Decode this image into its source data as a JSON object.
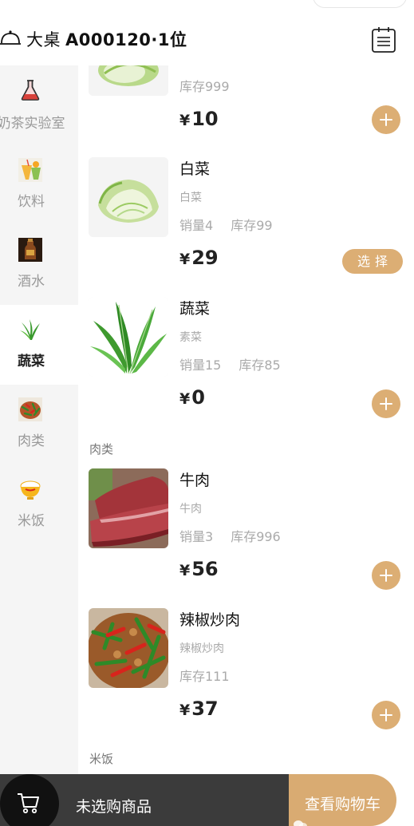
{
  "header": {
    "table_name": "大桌",
    "table_code": "A000120·1位",
    "left_icon": "bell-icon",
    "right_icon": "order-list-icon"
  },
  "sidebar": {
    "categories": [
      {
        "label": "奶茶实验室",
        "icon": "flask-icon",
        "active": false
      },
      {
        "label": "饮料",
        "icon": "drink-icon",
        "active": false
      },
      {
        "label": "酒水",
        "icon": "liquor-icon",
        "active": false
      },
      {
        "label": "蔬菜",
        "icon": "vegetable-icon",
        "active": true
      },
      {
        "label": "肉类",
        "icon": "meat-icon",
        "active": false
      },
      {
        "label": "米饭",
        "icon": "rice-bowl-icon",
        "active": false
      }
    ]
  },
  "products": [
    {
      "name": "",
      "desc": "",
      "stock": "库存999",
      "price": "10",
      "action": "add"
    },
    {
      "name": "白菜",
      "desc": "白菜",
      "sales": "销量4",
      "stock": "库存99",
      "price": "29",
      "action": "select",
      "action_label": "选择"
    },
    {
      "name": "蔬菜",
      "desc": "素菜",
      "sales": "销量15",
      "stock": "库存85",
      "price": "0",
      "action": "add"
    },
    {
      "name": "牛肉",
      "desc": "牛肉",
      "sales": "销量3",
      "stock": "库存996",
      "price": "56",
      "action": "add"
    },
    {
      "name": "辣椒炒肉",
      "desc": "辣椒炒肉",
      "stock": "库存111",
      "price": "37",
      "action": "add"
    }
  ],
  "sections": {
    "meat": "肉类",
    "rice": "米饭"
  },
  "currency": "¥",
  "cart": {
    "status": "未选购商品",
    "view_button": "查看购物车",
    "icon": "cart-icon"
  },
  "colors": {
    "accent": "#dcae74",
    "cart_bar": "#3b3b3b",
    "cart_circle": "#111111",
    "sidebar_bg": "#f5f5f5"
  }
}
